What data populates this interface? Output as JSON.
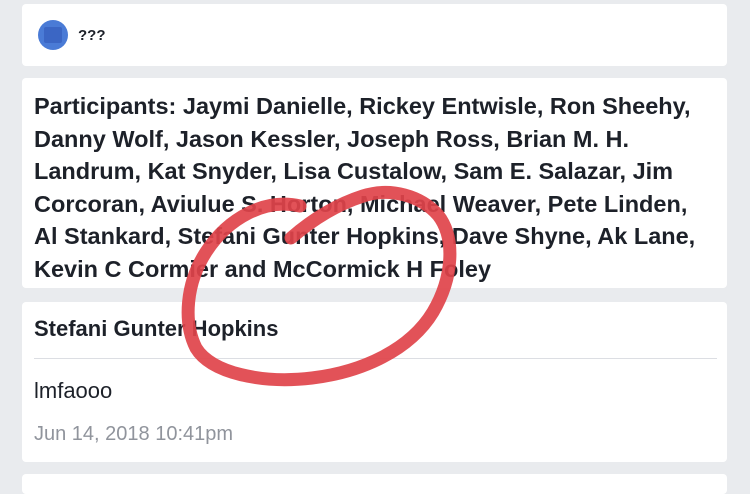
{
  "thread": {
    "name": "???",
    "avatar_icon": "group-avatar-icon"
  },
  "participants": {
    "text": "Participants: Jaymi Danielle, Rickey Entwisle, Ron Sheehy, Danny Wolf, Jason Kessler, Joseph Ross, Brian M. H. Landrum, Kat Snyder, Lisa Custalow, Sam E. Salazar, Jim Corcoran, Aviulue S. Horton, Michael Weaver, Pete Linden, Al Stankard, Stefani Gunter Hopkins, Dave Shyne, Ak Lane, Kevin C Cormier and McCormick H Foley"
  },
  "message": {
    "sender": "Stefani Gunter Hopkins",
    "body": "lmfaooo",
    "timestamp": "Jun 14, 2018 10:41pm"
  },
  "colors": {
    "page_bg": "#e9ebee",
    "card_bg": "#ffffff",
    "text": "#1d2129",
    "muted_text": "#90949c",
    "annotation_red": "#e0434a",
    "avatar_blue": "#4a7bd6"
  }
}
